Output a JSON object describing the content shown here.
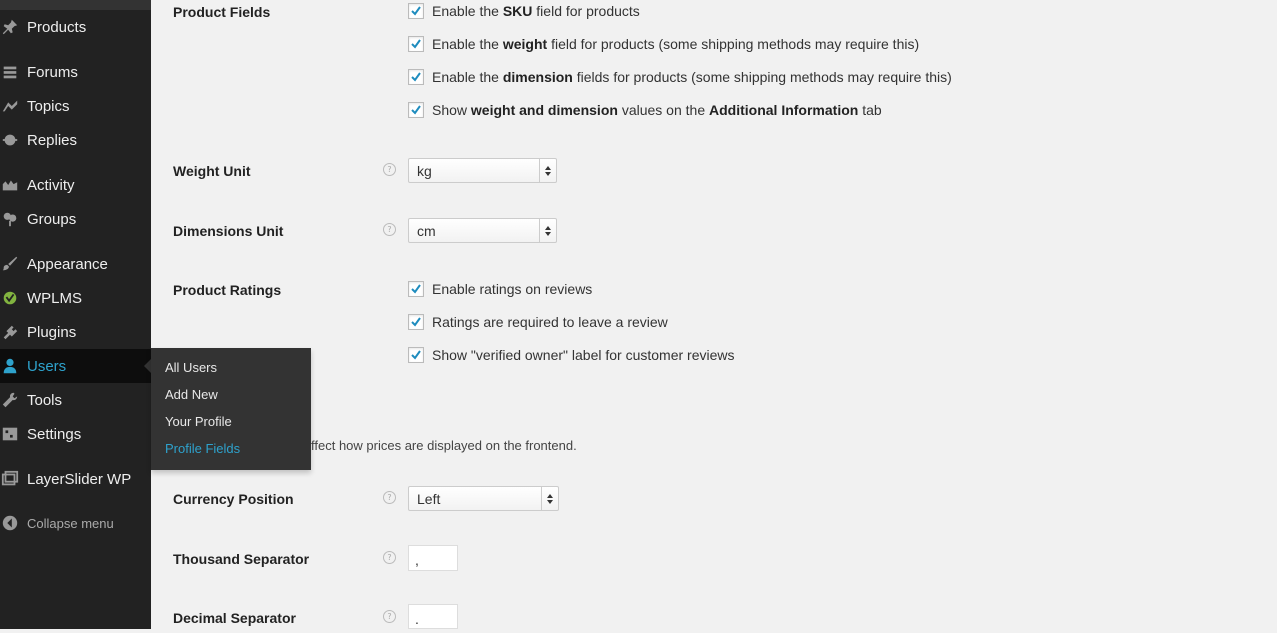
{
  "sidebar": {
    "items": [
      {
        "label": "Products",
        "icon": "pin-icon"
      },
      {
        "label": "Forums",
        "icon": "forums-icon"
      },
      {
        "label": "Topics",
        "icon": "topics-icon"
      },
      {
        "label": "Replies",
        "icon": "replies-icon"
      },
      {
        "label": "Activity",
        "icon": "activity-icon"
      },
      {
        "label": "Groups",
        "icon": "groups-icon"
      },
      {
        "label": "Appearance",
        "icon": "brush-icon"
      },
      {
        "label": "WPLMS",
        "icon": "wplms-icon"
      },
      {
        "label": "Plugins",
        "icon": "plug-icon"
      },
      {
        "label": "Users",
        "icon": "user-icon"
      },
      {
        "label": "Tools",
        "icon": "wrench-icon"
      },
      {
        "label": "Settings",
        "icon": "settings-icon"
      },
      {
        "label": "LayerSlider WP",
        "icon": "layers-icon"
      }
    ],
    "collapse_label": "Collapse menu",
    "accent_color": "#2ea2cc"
  },
  "users_submenu": {
    "items": [
      "All Users",
      "Add New",
      "Your Profile",
      "Profile Fields"
    ],
    "current": "Profile Fields"
  },
  "main": {
    "product_fields": {
      "label": "Product Fields",
      "options": [
        {
          "pre": "Enable the ",
          "bold": "SKU",
          "post": " field for products",
          "checked": true
        },
        {
          "pre": "Enable the ",
          "bold": "weight",
          "post": " field for products (some shipping methods may require this)",
          "checked": true
        },
        {
          "pre": "Enable the ",
          "bold": "dimension",
          "post": " fields for products (some shipping methods may require this)",
          "checked": true
        },
        {
          "pre": "Show ",
          "bold": "weight and dimension",
          "post": " values on the ",
          "bold2": "Additional Information",
          "post2": " tab",
          "checked": true
        }
      ]
    },
    "weight_unit": {
      "label": "Weight Unit",
      "value": "kg"
    },
    "dimensions_unit": {
      "label": "Dimensions Unit",
      "value": "cm"
    },
    "product_ratings": {
      "label": "Product Ratings",
      "options": [
        {
          "text": "Enable ratings on reviews",
          "checked": true
        },
        {
          "text": "Ratings are required to leave a review",
          "checked": true
        },
        {
          "text": "Show \"verified owner\" label for customer reviews",
          "checked": true
        }
      ]
    },
    "pricing_description": "ffect how prices are displayed on the frontend.",
    "currency_position": {
      "label": "Currency Position",
      "value": "Left"
    },
    "thousand_separator": {
      "label": "Thousand Separator",
      "value": ","
    },
    "decimal_separator": {
      "label": "Decimal Separator",
      "value": "."
    }
  }
}
